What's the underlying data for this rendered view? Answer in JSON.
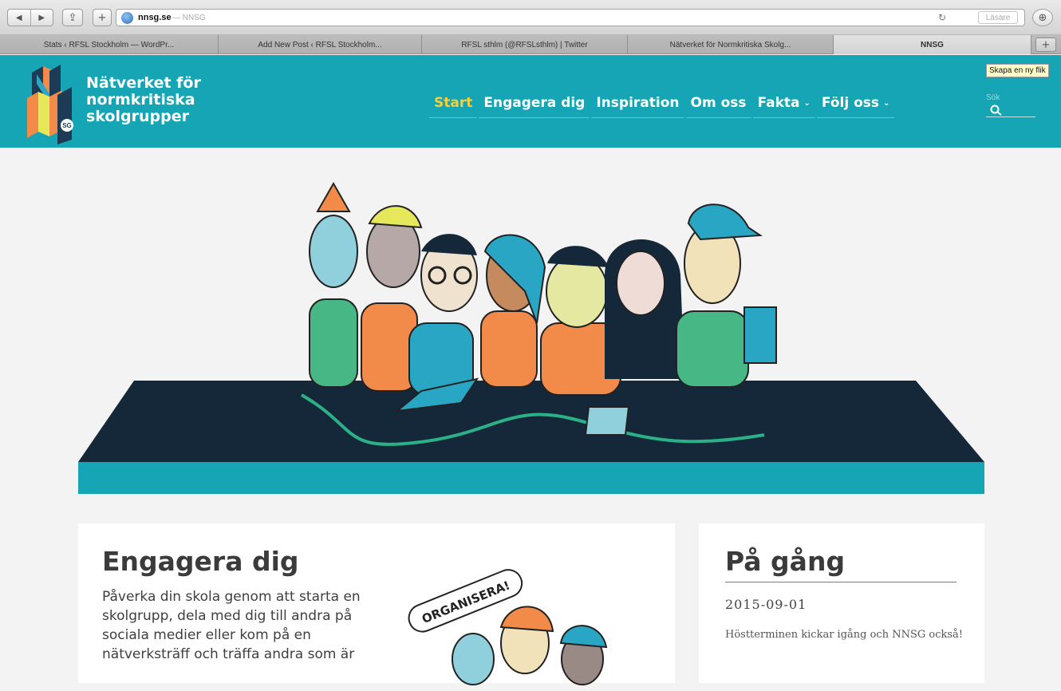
{
  "browser": {
    "url_host": "nnsg.se",
    "url_title": "— NNSG",
    "reader_label": "Läsare",
    "reload_glyph": "↻",
    "share_glyph": "⇪",
    "add_glyph": "+",
    "download_glyph": "⊕",
    "back_glyph": "◀",
    "forward_glyph": "▶",
    "new_tab_glyph": "+",
    "tooltip": "Skapa en ny flik",
    "tabs": [
      {
        "label": "Stats ‹ RFSL Stockholm — WordPr..."
      },
      {
        "label": "Add New Post ‹ RFSL Stockholm..."
      },
      {
        "label": "RFSL sthlm (@RFSLsthlm) | Twitter"
      },
      {
        "label": "Nätverket för Normkritiska Skolg..."
      },
      {
        "label": "NNSG"
      }
    ]
  },
  "site": {
    "logo_lines": [
      "Nätverket för",
      "normkritiska",
      "skolgrupper"
    ],
    "nav": [
      {
        "label": "Start"
      },
      {
        "label": "Engagera dig"
      },
      {
        "label": "Inspiration"
      },
      {
        "label": "Om oss"
      },
      {
        "label": "Fakta",
        "caret": "⌄"
      },
      {
        "label": "Följ oss",
        "caret": "⌄"
      }
    ],
    "search_placeholder": "Sök",
    "colors": {
      "brand": "#16a5b4",
      "nav_active": "#f4d03f",
      "table": "#14283a"
    }
  },
  "engage": {
    "title": "Engagera dig",
    "text": "Påverka din skola genom att starta en skolgrupp, dela med dig till andra på sociala medier eller kom på en nätverksträff och träffa andra som är",
    "sign": "ORGANISERA!"
  },
  "news": {
    "title": "På gång",
    "date": "2015-09-01",
    "text": "Höstterminen kickar igång och NNSG också!"
  }
}
